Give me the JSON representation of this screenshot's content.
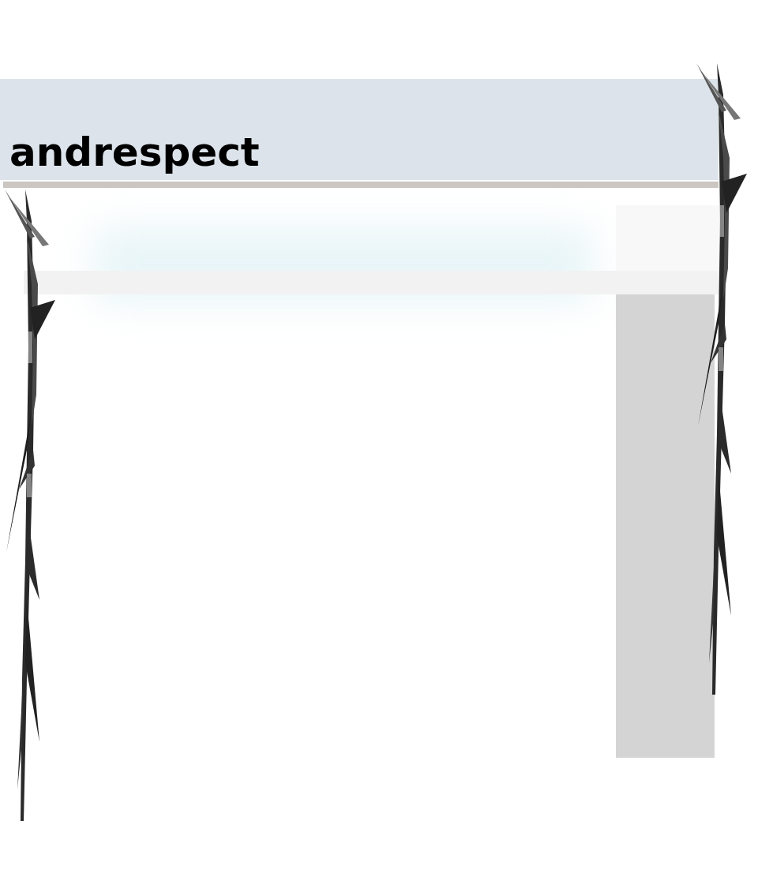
{
  "page": {
    "title": "andrespect"
  }
}
